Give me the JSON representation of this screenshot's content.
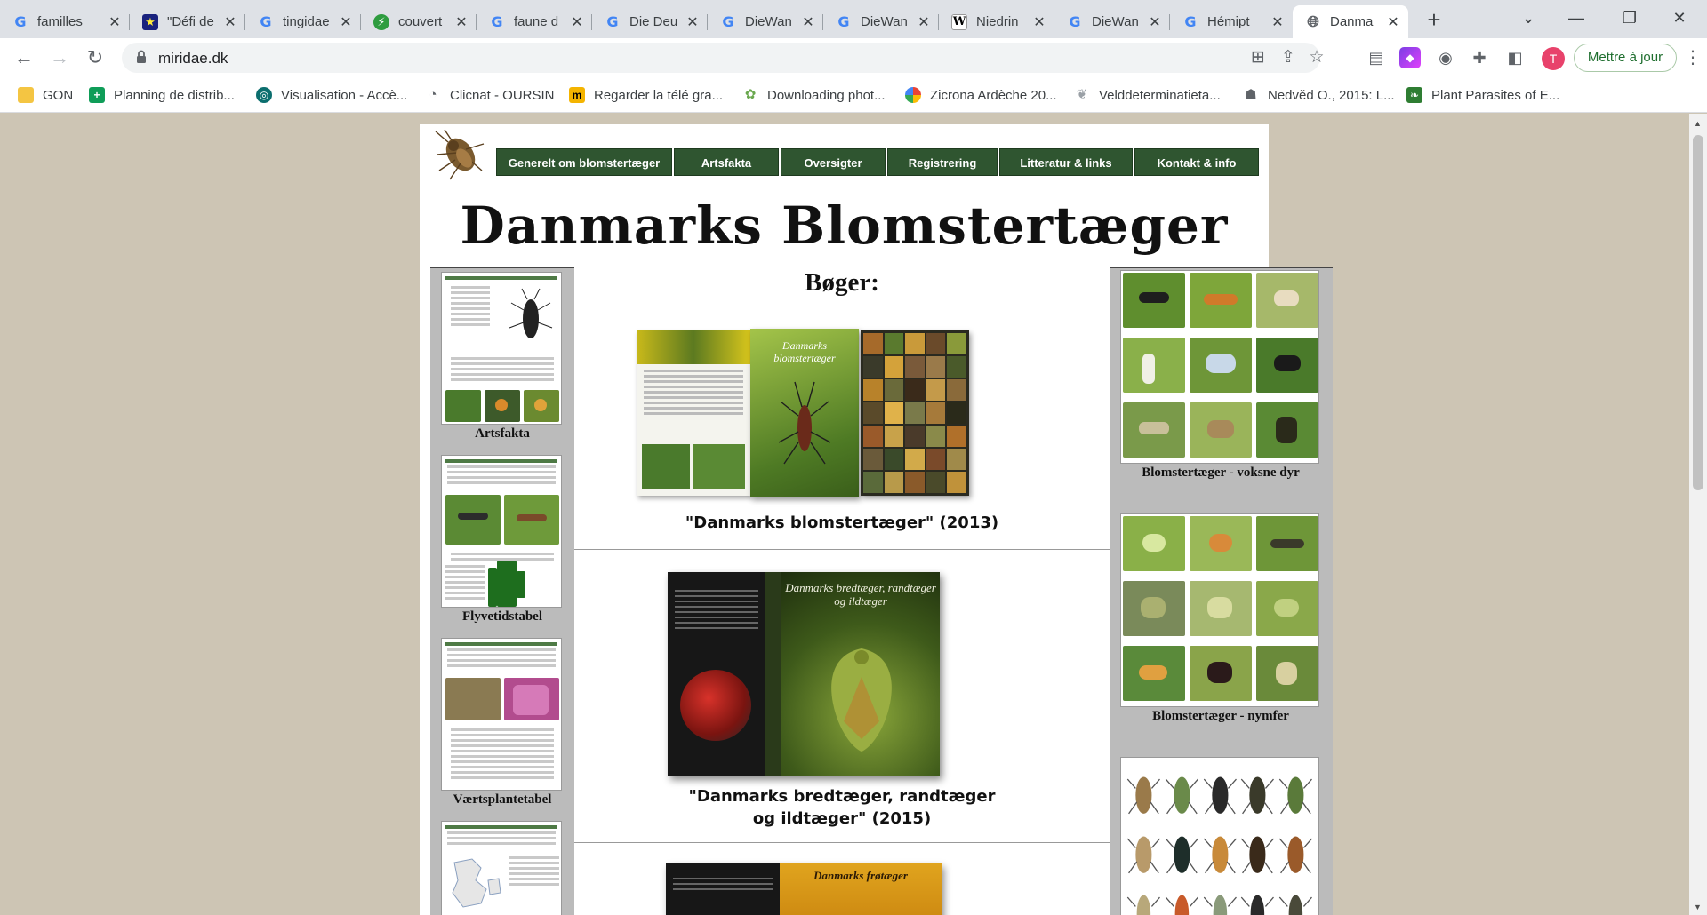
{
  "browser": {
    "tabs": [
      {
        "title": "familles",
        "icon": "google-icon"
      },
      {
        "title": "\"Défi de",
        "icon": "defi-site-icon"
      },
      {
        "title": "tingidae",
        "icon": "google-icon"
      },
      {
        "title": "couvert",
        "icon": "green-bolt-icon"
      },
      {
        "title": "faune d",
        "icon": "google-icon"
      },
      {
        "title": "Die Deu",
        "icon": "google-icon"
      },
      {
        "title": "DieWan",
        "icon": "google-icon"
      },
      {
        "title": "DieWan",
        "icon": "google-icon"
      },
      {
        "title": "Niedrin",
        "icon": "wiki-icon"
      },
      {
        "title": "DieWan",
        "icon": "google-icon"
      },
      {
        "title": "Hémipt",
        "icon": "google-icon"
      },
      {
        "title": "Danma",
        "icon": "globe-icon",
        "active": true
      }
    ],
    "url": "miridae.dk",
    "update_label": "Mettre à jour",
    "profile_initial": "T",
    "bookmarks": [
      {
        "label": "GON",
        "icon": "folder-icon",
        "color": "#f4c542"
      },
      {
        "label": "Planning de distrib...",
        "icon": "plus-icon",
        "color": "#0f9d58"
      },
      {
        "label": "Visualisation - Accè...",
        "icon": "circle-icon",
        "color": "#0b6e6e"
      },
      {
        "label": "Clicnat - OURSIN",
        "icon": "rss-icon",
        "color": "#5f6368"
      },
      {
        "label": "Regarder la télé gra...",
        "icon": "m-icon",
        "color": "#f4b400"
      },
      {
        "label": "Downloading phot...",
        "icon": "plant-icon",
        "color": "#6aa84f"
      },
      {
        "label": "Zicrona Ardèche 20...",
        "icon": "pinwheel-icon",
        "color": "#ea4335"
      },
      {
        "label": "Velddeterminatieta...",
        "icon": "leaf-icon",
        "color": "#9aa0a6"
      },
      {
        "label": "Nedvěd O., 2015: L...",
        "icon": "robot-icon",
        "color": "#5f6368"
      },
      {
        "label": "Plant Parasites of E...",
        "icon": "leaf-square-icon",
        "color": "#2e7d32"
      }
    ]
  },
  "site": {
    "title": "Danmarks Blomstertæger",
    "nav": [
      "Generelt om blomstertæger",
      "Artsfakta",
      "Oversigter",
      "Registrering",
      "Litteratur & links",
      "Kontakt & info"
    ],
    "left_thumbs": [
      {
        "label": "Artsfakta"
      },
      {
        "label": "Flyvetidstabel"
      },
      {
        "label": "Værtsplantetabel"
      },
      {
        "label": ""
      }
    ],
    "right_thumbs": [
      {
        "label": "Blomstertæger - voksne dyr"
      },
      {
        "label": "Blomstertæger - nymfer"
      }
    ],
    "books_heading": "Bøger:",
    "books": [
      {
        "caption": "\"Danmarks blomstertæger\" (2013)",
        "cover_title": "Danmarks blomstertæger"
      },
      {
        "caption": "\"Danmarks bredtæger, randtæger og ildtæger\" (2015)",
        "cover_title": "Danmarks bredtæger, randtæger og ildtæger"
      },
      {
        "caption": "",
        "cover_title": "Danmarks frøtæger"
      }
    ]
  }
}
